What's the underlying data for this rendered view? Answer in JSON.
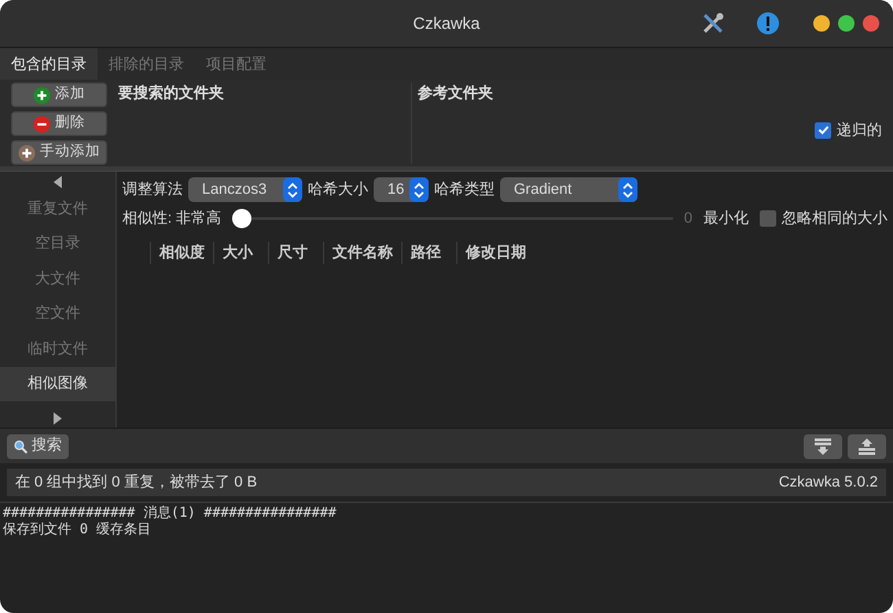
{
  "window": {
    "title": "Czkawka"
  },
  "tabs": [
    {
      "label": "包含的目录",
      "selected": true
    },
    {
      "label": "排除的目录",
      "selected": false
    },
    {
      "label": "项目配置",
      "selected": false
    }
  ],
  "directory_buttons": [
    {
      "label": "添加",
      "kind": "add"
    },
    {
      "label": "删除",
      "kind": "remove"
    },
    {
      "label": "手动添加",
      "kind": "manual"
    }
  ],
  "directory_columns": [
    "要搜索的文件夹",
    "参考文件夹"
  ],
  "recursive": {
    "label": "递归的",
    "checked": true
  },
  "sidebar": {
    "items": [
      {
        "label": "重复文件",
        "selected": false
      },
      {
        "label": "空目录",
        "selected": false
      },
      {
        "label": "大文件",
        "selected": false
      },
      {
        "label": "空文件",
        "selected": false
      },
      {
        "label": "临时文件",
        "selected": false
      },
      {
        "label": "相似图像",
        "selected": true
      }
    ]
  },
  "options": {
    "resize_algorithm": {
      "label": "调整算法",
      "value": "Lanczos3"
    },
    "hash_size": {
      "label": "哈希大小",
      "value": "16"
    },
    "hash_type": {
      "label": "哈希类型",
      "value": "Gradient"
    },
    "similarity": {
      "label": "相似性: 非常高",
      "level": 0,
      "reading": "0",
      "end_label": "最小化"
    },
    "ignore_same_size": {
      "label": "忽略相同的大小",
      "checked": false
    }
  },
  "result_columns": [
    "相似度",
    "大小",
    "尺寸",
    "文件名称",
    "路径",
    "修改日期"
  ],
  "search_button": "搜索",
  "status_bar": {
    "message": "在 0 组中找到 0 重复，被带去了 0 B",
    "version": "Czkawka 5.0.2"
  },
  "log": [
    "################ 消息(1) ################",
    "保存到文件 0 缓存条目"
  ]
}
